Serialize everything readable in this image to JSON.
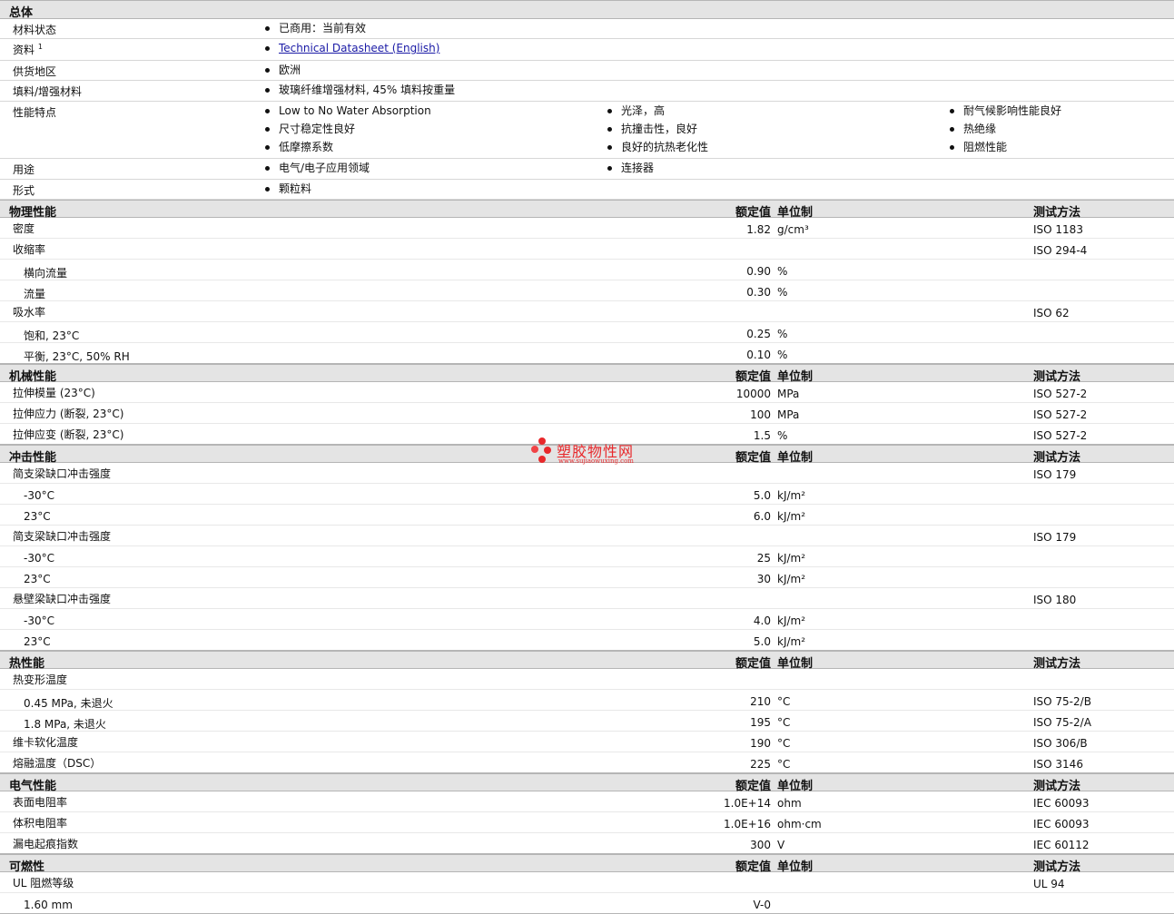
{
  "general": {
    "title": "总体",
    "rows": [
      {
        "label": "材料状态",
        "items": [
          "已商用：当前有效"
        ]
      },
      {
        "label": "资料",
        "sup": "1",
        "items": [
          "Technical Datasheet (English)"
        ],
        "link": true
      },
      {
        "label": "供货地区",
        "items": [
          "欧洲"
        ]
      },
      {
        "label": "填料/增强材料",
        "items": [
          "玻璃纤维增强材料, 45% 填料按重量"
        ]
      },
      {
        "label": "性能特点",
        "items": [
          "Low to No Water Absorption",
          "光泽，高",
          "耐气候影响性能良好",
          "尺寸稳定性良好",
          "抗撞击性，良好",
          "热绝缘",
          "低摩擦系数",
          "良好的抗热老化性",
          "阻燃性能"
        ]
      },
      {
        "label": "用途",
        "items": [
          "电气/电子应用领域",
          "连接器"
        ]
      },
      {
        "label": "形式",
        "items": [
          "颗粒料"
        ]
      }
    ]
  },
  "headers": {
    "nominal": "额定值",
    "unit": "单位制",
    "method": "测试方法"
  },
  "sections": [
    {
      "title": "物理性能",
      "rows": [
        {
          "label": "密度",
          "value": "1.82",
          "unit": "g/cm³",
          "method": "ISO 1183"
        },
        {
          "label": "收缩率",
          "method": "ISO 294-4"
        },
        {
          "label": "横向流量",
          "sub": true,
          "value": "0.90",
          "unit": "%"
        },
        {
          "label": "流量",
          "sub": true,
          "value": "0.30",
          "unit": "%"
        },
        {
          "label": "吸水率",
          "method": "ISO 62"
        },
        {
          "label": "饱和, 23°C",
          "sub": true,
          "value": "0.25",
          "unit": "%"
        },
        {
          "label": "平衡, 23°C, 50% RH",
          "sub": true,
          "value": "0.10",
          "unit": "%"
        }
      ]
    },
    {
      "title": "机械性能",
      "rows": [
        {
          "label": "拉伸模量 (23°C)",
          "value": "10000",
          "unit": "MPa",
          "method": "ISO 527-2"
        },
        {
          "label": "拉伸应力 (断裂, 23°C)",
          "value": "100",
          "unit": "MPa",
          "method": "ISO 527-2"
        },
        {
          "label": "拉伸应变 (断裂, 23°C)",
          "value": "1.5",
          "unit": "%",
          "method": "ISO 527-2"
        }
      ]
    },
    {
      "title": "冲击性能",
      "rows": [
        {
          "label": "简支梁缺口冲击强度",
          "method": "ISO 179"
        },
        {
          "label": "-30°C",
          "sub": true,
          "value": "5.0",
          "unit": "kJ/m²"
        },
        {
          "label": "23°C",
          "sub": true,
          "value": "6.0",
          "unit": "kJ/m²"
        },
        {
          "label": "简支梁缺口冲击强度",
          "method": "ISO 179"
        },
        {
          "label": "-30°C",
          "sub": true,
          "value": "25",
          "unit": "kJ/m²"
        },
        {
          "label": "23°C",
          "sub": true,
          "value": "30",
          "unit": "kJ/m²"
        },
        {
          "label": "悬壁梁缺口冲击强度",
          "method": "ISO 180"
        },
        {
          "label": "-30°C",
          "sub": true,
          "value": "4.0",
          "unit": "kJ/m²"
        },
        {
          "label": "23°C",
          "sub": true,
          "value": "5.0",
          "unit": "kJ/m²"
        }
      ]
    },
    {
      "title": "热性能",
      "rows": [
        {
          "label": "热变形温度"
        },
        {
          "label": "0.45 MPa, 未退火",
          "sub": true,
          "value": "210",
          "unit": "°C",
          "method": "ISO 75-2/B"
        },
        {
          "label": "1.8 MPa, 未退火",
          "sub": true,
          "value": "195",
          "unit": "°C",
          "method": "ISO 75-2/A"
        },
        {
          "label": "维卡软化温度",
          "value": "190",
          "unit": "°C",
          "method": "ISO 306/B"
        },
        {
          "label": "熔融温度（DSC）",
          "value": "225",
          "unit": "°C",
          "method": "ISO 3146"
        }
      ]
    },
    {
      "title": "电气性能",
      "rows": [
        {
          "label": "表面电阻率",
          "value": "1.0E+14",
          "unit": "ohm",
          "method": "IEC 60093"
        },
        {
          "label": "体积电阻率",
          "value": "1.0E+16",
          "unit": "ohm·cm",
          "method": "IEC 60093"
        },
        {
          "label": "漏电起痕指数",
          "value": "300",
          "unit": "V",
          "method": "IEC 60112"
        }
      ]
    },
    {
      "title": "可燃性",
      "rows": [
        {
          "label": "UL 阻燃等级",
          "method": "UL 94"
        },
        {
          "label": "1.60 mm",
          "sub": true,
          "value": "V-0"
        }
      ]
    }
  ],
  "watermark": {
    "name": "塑胶物性网",
    "url": "www.sujiaowuxing.com"
  }
}
